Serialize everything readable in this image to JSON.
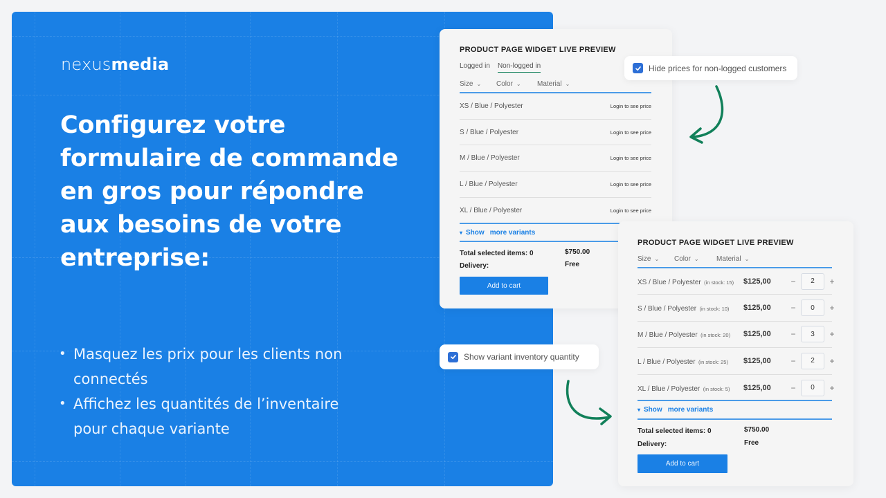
{
  "brand": {
    "light": "nexus",
    "bold": "media"
  },
  "headline": "Configurez votre formulaire de commande en gros pour répondre aux besoins de votre entreprise:",
  "bullets": [
    "Masquez les prix pour les clients non connectés",
    "Affichez les quantités de l’inventaire pour chaque variante"
  ],
  "colors": {
    "hero_bg": "#1a80e5",
    "accent": "#1a80e5",
    "arrow": "#11805a",
    "checkbox": "#2d6fd6"
  },
  "widget_non_logged": {
    "title": "PRODUCT PAGE WIDGET LIVE PREVIEW",
    "tabs": [
      {
        "label": "Logged in",
        "active": false
      },
      {
        "label": "Non-logged in",
        "active": true
      }
    ],
    "filters": [
      "Size",
      "Color",
      "Material"
    ],
    "rows": [
      {
        "variant": "XS / Blue / Polyester",
        "price_text": "Login to see price"
      },
      {
        "variant": "S / Blue / Polyester",
        "price_text": "Login to see price"
      },
      {
        "variant": "M / Blue / Polyester",
        "price_text": "Login to see price"
      },
      {
        "variant": "L / Blue / Polyester",
        "price_text": "Login to see price"
      },
      {
        "variant": "XL / Blue / Polyester",
        "price_text": "Login to see price"
      }
    ],
    "show_more": {
      "word1": "Show",
      "word2": "more variants"
    },
    "total_label": "Total selected items: 0",
    "total_value": "$750.00",
    "delivery_label": "Delivery:",
    "delivery_value": "Free",
    "cart_button": "Add to cart"
  },
  "widget_inventory": {
    "title": "PRODUCT PAGE WIDGET LIVE PREVIEW",
    "filters": [
      "Size",
      "Color",
      "Material"
    ],
    "rows": [
      {
        "variant": "XS / Blue / Polyester",
        "stock": "(in stock: 15)",
        "price": "$125,00",
        "qty": "2"
      },
      {
        "variant": "S / Blue / Polyester",
        "stock": "(in stock: 10)",
        "price": "$125,00",
        "qty": "0"
      },
      {
        "variant": "M / Blue / Polyester",
        "stock": "(in stock: 20)",
        "price": "$125,00",
        "qty": "3"
      },
      {
        "variant": "L / Blue / Polyester",
        "stock": "(in stock: 25)",
        "price": "$125,00",
        "qty": "2"
      },
      {
        "variant": "XL / Blue / Polyester",
        "stock": "(in stock: 5)",
        "price": "$125,00",
        "qty": "0"
      }
    ],
    "show_more": {
      "word1": "Show",
      "word2": "more variants"
    },
    "total_label": "Total selected items: 0",
    "total_value": "$750.00",
    "delivery_label": "Delivery:",
    "delivery_value": "Free",
    "cart_button": "Add to cart"
  },
  "options": {
    "hide_prices": {
      "label": "Hide prices for non-logged customers",
      "checked": true
    },
    "show_inventory": {
      "label": "Show variant inventory quantity",
      "checked": true
    }
  },
  "qty_controls": {
    "minus": "−",
    "plus": "+"
  },
  "icons": {
    "chevron": "⌄",
    "triangle": "▾",
    "check": "✓",
    "bullet": "•"
  }
}
